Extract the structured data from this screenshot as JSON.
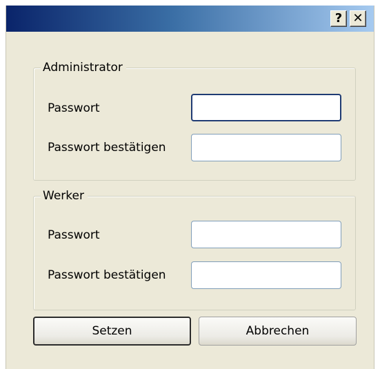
{
  "titlebar": {
    "title": "",
    "help_label": "?",
    "close_label": "✕"
  },
  "admin_group": {
    "legend": "Administrator",
    "password_label": "Passwort",
    "password_value": "",
    "confirm_label": "Passwort bestätigen",
    "confirm_value": ""
  },
  "worker_group": {
    "legend": "Werker",
    "password_label": "Passwort",
    "password_value": "",
    "confirm_label": "Passwort bestätigen",
    "confirm_value": ""
  },
  "buttons": {
    "set_label": "Setzen",
    "cancel_label": "Abbrechen"
  },
  "colors": {
    "titlebar_start": "#0a246a",
    "titlebar_end": "#a6caf0",
    "dialog_bg": "#ece9d8"
  }
}
